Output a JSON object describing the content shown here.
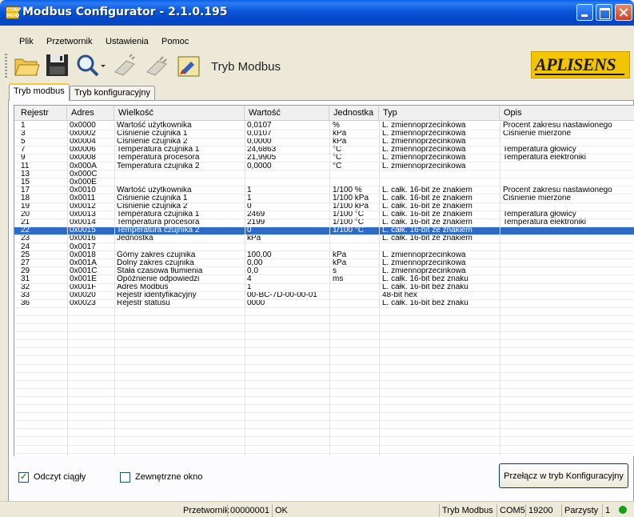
{
  "window": {
    "title": "Modbus Configurator - 2.1.0.195",
    "icon_text": "CONF MOD"
  },
  "menu": [
    "Plik",
    "Przetwornik",
    "Ustawienia",
    "Pomoc"
  ],
  "toolbar": {
    "icons": [
      "open-folder-icon",
      "save-icon",
      "search-icon",
      "read-device-icon",
      "write-device-icon",
      "mode-switch-icon"
    ],
    "mode_label": "Tryb Modbus",
    "logo_text": "APLISENS"
  },
  "tabs": [
    "Tryb modbus",
    "Tryb konfiguracyjny"
  ],
  "table": {
    "columns": [
      "Rejestr",
      "Adres",
      "Wielkość",
      "Wartość",
      "Jednostka",
      "Typ",
      "Opis"
    ],
    "rows": [
      [
        "1",
        "0x0000",
        "Wartość użytkownika",
        "0,0107",
        "%",
        "L. zmiennoprzecinkowa",
        "Procent zakresu nastawionego"
      ],
      [
        "3",
        "0x0002",
        "Ciśnienie czujnika 1",
        "0,0107",
        "kPa",
        "L. zmiennoprzecinkowa",
        "Ciśnienie mierzone"
      ],
      [
        "5",
        "0x0004",
        "Ciśnienie czujnika 2",
        "0,0000",
        "kPa",
        "L. zmiennoprzecinkowa",
        ""
      ],
      [
        "7",
        "0x0006",
        "Temperatura czujnika 1",
        "24,6863",
        "°C",
        "L. zmiennoprzecinkowa",
        "Temperatura głowicy"
      ],
      [
        "9",
        "0x0008",
        "Temperatura procesora",
        "21,9905",
        "°C",
        "L. zmiennoprzecinkowa",
        "Temperatura elektroniki"
      ],
      [
        "11",
        "0x000A",
        "Temperatura czujnika 2",
        "0,0000",
        "°C",
        "L. zmiennoprzecinkowa",
        ""
      ],
      [
        "13",
        "0x000C",
        "",
        "",
        "",
        "",
        ""
      ],
      [
        "15",
        "0x000E",
        "",
        "",
        "",
        "",
        ""
      ],
      [
        "17",
        "0x0010",
        "Wartość użytkownika",
        "1",
        "1/100 %",
        "L. całk. 16-bit ze znakiem",
        "Procent zakresu nastawionego"
      ],
      [
        "18",
        "0x0011",
        "Ciśnienie czujnika 1",
        "1",
        "1/100 kPa",
        "L. całk. 16-bit ze znakiem",
        "Ciśnienie mierzone"
      ],
      [
        "19",
        "0x0012",
        "Ciśnienie czujnika 2",
        "0",
        "1/100 kPa",
        "L. całk. 16-bit ze znakiem",
        ""
      ],
      [
        "20",
        "0x0013",
        "Temperatura czujnika 1",
        "2469",
        "1/100 °C",
        "L. całk. 16-bit ze znakiem",
        "Temperatura głowicy"
      ],
      [
        "21",
        "0x0014",
        "Temperatura procesora",
        "2199",
        "1/100 °C",
        "L. całk. 16-bit ze znakiem",
        "Temperatura elektroniki"
      ],
      [
        "22",
        "0x0015",
        "Temperatura czujnika 2",
        "0",
        "1/100 °C",
        "L. całk. 16-bit ze znakiem",
        ""
      ],
      [
        "23",
        "0x0016",
        "Jednostka",
        "kPa",
        "",
        "L. całk. 16-bit ze znakiem",
        ""
      ],
      [
        "24",
        "0x0017",
        "",
        "",
        "",
        "",
        ""
      ],
      [
        "25",
        "0x0018",
        "Górny zakres czujnika",
        "100,00",
        "kPa",
        "L. zmiennoprzecinkowa",
        ""
      ],
      [
        "27",
        "0x001A",
        "Dolny zakres czujnika",
        "0,00",
        "kPa",
        "L. zmiennoprzecinkowa",
        ""
      ],
      [
        "29",
        "0x001C",
        "Stała czasowa tłumienia",
        "0,0",
        "s",
        "L. zmiennoprzecinkowa",
        ""
      ],
      [
        "31",
        "0x001E",
        "Opóźnienie odpowiedzi",
        "4",
        "ms",
        "L. całk. 16-bit bez znaku",
        ""
      ],
      [
        "32",
        "0x001F",
        "Adres Modbus",
        "1",
        "",
        "L. całk. 16-bit bez znaku",
        ""
      ],
      [
        "33",
        "0x0020",
        "Rejestr identyfikacyjny",
        "00-BC-7D-00-00-01",
        "",
        "48-bit hex",
        ""
      ],
      [
        "36",
        "0x0023",
        "Rejestr statusu",
        "0000",
        "",
        "L. całk. 16-bit bez znaku",
        ""
      ]
    ],
    "selected_row": 13
  },
  "controls": {
    "continuous_read_label": "Odczyt ciągły",
    "continuous_read_checked": true,
    "external_window_label": "Zewnętrzne okno",
    "external_window_checked": false,
    "switch_button_label": "Przełącz w tryb Konfiguracyjny"
  },
  "status": {
    "device_label": "Przetwornik",
    "device_id": "00000001",
    "state": "OK",
    "mode": "Tryb Modbus",
    "port": "COM5",
    "baud": "19200",
    "parity": "Parzysty",
    "stop_bits": "1",
    "indicator_color": "#14a014"
  },
  "colors": {
    "selection": "#316ac5",
    "titlebar": "#0a55d8",
    "logo": "#f3c400"
  }
}
